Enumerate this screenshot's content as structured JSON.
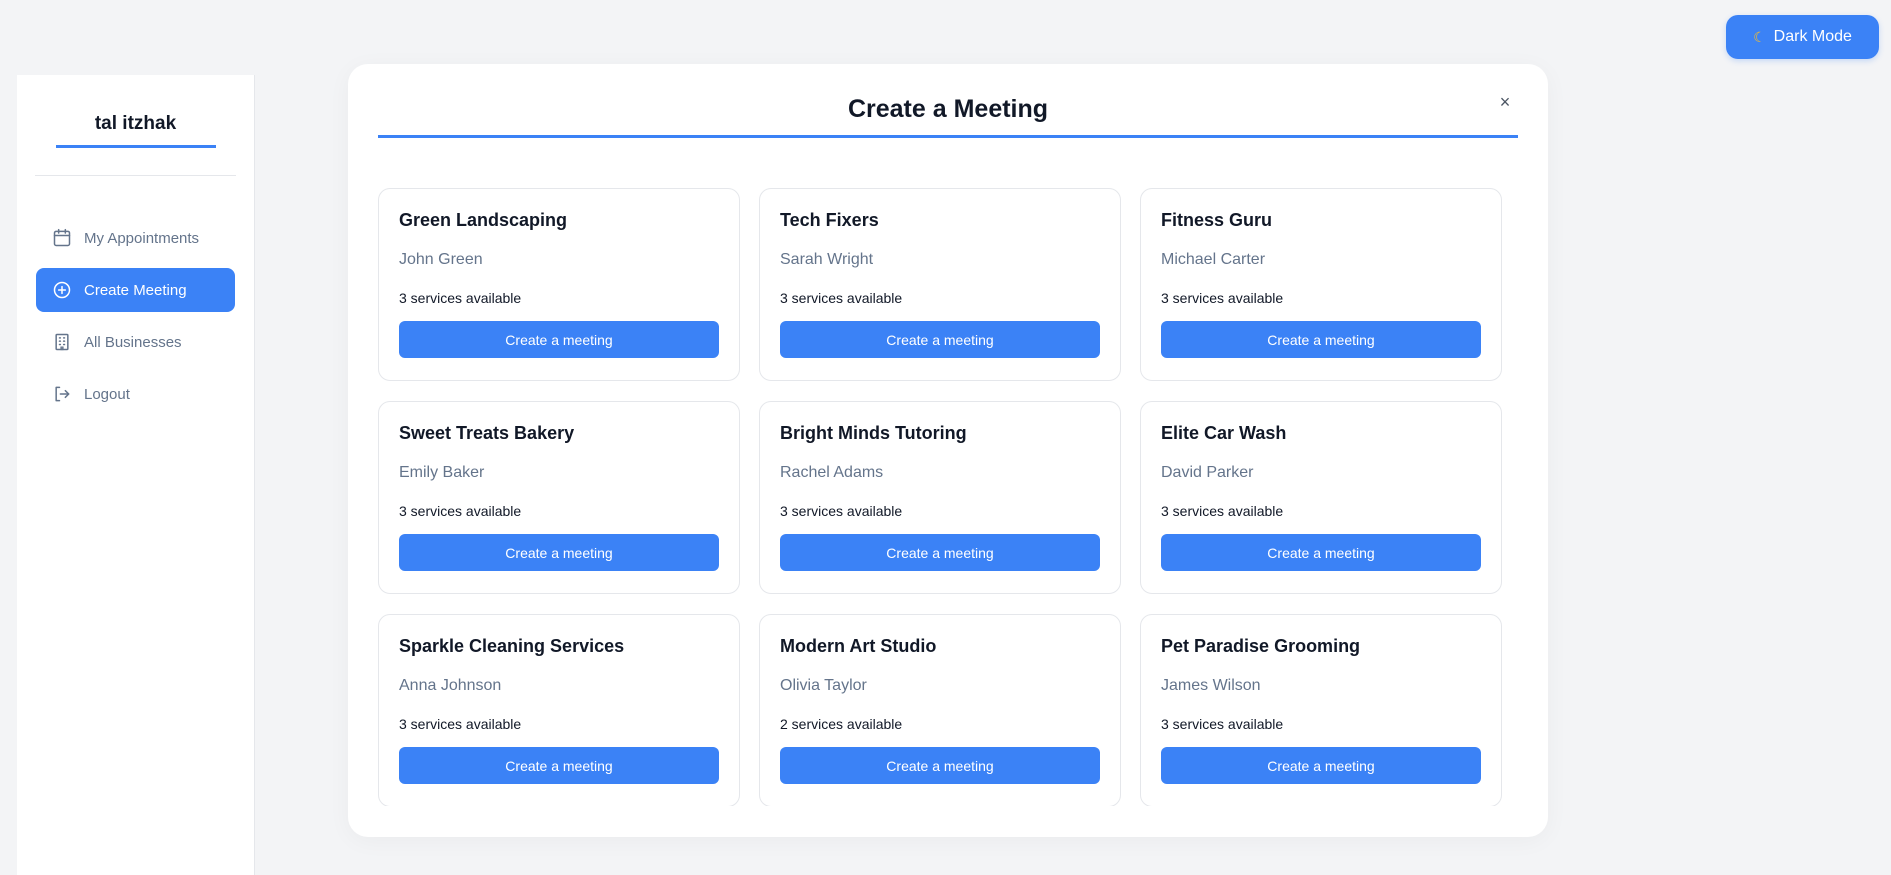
{
  "dark_mode": {
    "icon": "moon-icon",
    "label": "Dark Mode"
  },
  "sidebar": {
    "user_name": "tal itzhak",
    "items": [
      {
        "label": "My Appointments",
        "icon": "calendar-icon",
        "active": false
      },
      {
        "label": "Create Meeting",
        "icon": "plus-circle-icon",
        "active": true
      },
      {
        "label": "All Businesses",
        "icon": "building-icon",
        "active": false
      },
      {
        "label": "Logout",
        "icon": "logout-icon",
        "active": false
      }
    ]
  },
  "modal": {
    "title": "Create a Meeting",
    "close_label": "×",
    "businesses": [
      {
        "name": "Green Landscaping",
        "owner": "John Green",
        "services": "3 services available",
        "button": "Create a meeting"
      },
      {
        "name": "Tech Fixers",
        "owner": "Sarah Wright",
        "services": "3 services available",
        "button": "Create a meeting"
      },
      {
        "name": "Fitness Guru",
        "owner": "Michael Carter",
        "services": "3 services available",
        "button": "Create a meeting"
      },
      {
        "name": "Sweet Treats Bakery",
        "owner": "Emily Baker",
        "services": "3 services available",
        "button": "Create a meeting"
      },
      {
        "name": "Bright Minds Tutoring",
        "owner": "Rachel Adams",
        "services": "3 services available",
        "button": "Create a meeting"
      },
      {
        "name": "Elite Car Wash",
        "owner": "David Parker",
        "services": "3 services available",
        "button": "Create a meeting"
      },
      {
        "name": "Sparkle Cleaning Services",
        "owner": "Anna Johnson",
        "services": "3 services available",
        "button": "Create a meeting"
      },
      {
        "name": "Modern Art Studio",
        "owner": "Olivia Taylor",
        "services": "2 services available",
        "button": "Create a meeting"
      },
      {
        "name": "Pet Paradise Grooming",
        "owner": "James Wilson",
        "services": "3 services available",
        "button": "Create a meeting"
      }
    ]
  },
  "colors": {
    "accent": "#3b82f6",
    "background": "#f3f4f6",
    "muted_text": "#64748b"
  }
}
